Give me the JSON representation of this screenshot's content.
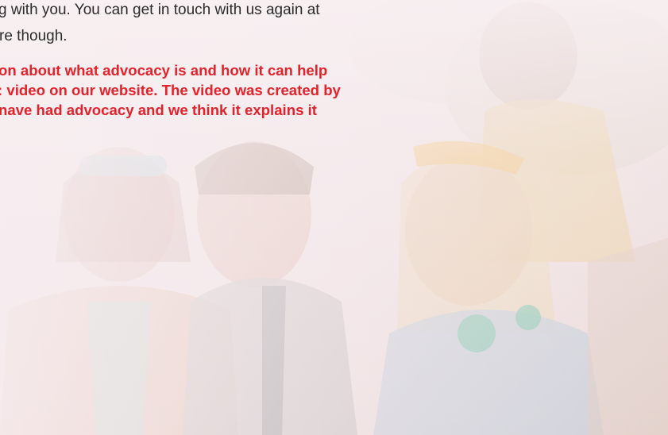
{
  "body_text": {
    "lines": [
      "g with you. You can get in touch with us again at",
      "re though."
    ]
  },
  "highlight_text": {
    "lines": [
      "on about what advocacy is and how it can help",
      ": video on our website. The video was created by",
      "nave had advocacy and we think it explains it"
    ]
  },
  "colors": {
    "body_text": "#2b2b2b",
    "highlight_text": "#e2232b",
    "background_tint": "#f3e6ea"
  }
}
